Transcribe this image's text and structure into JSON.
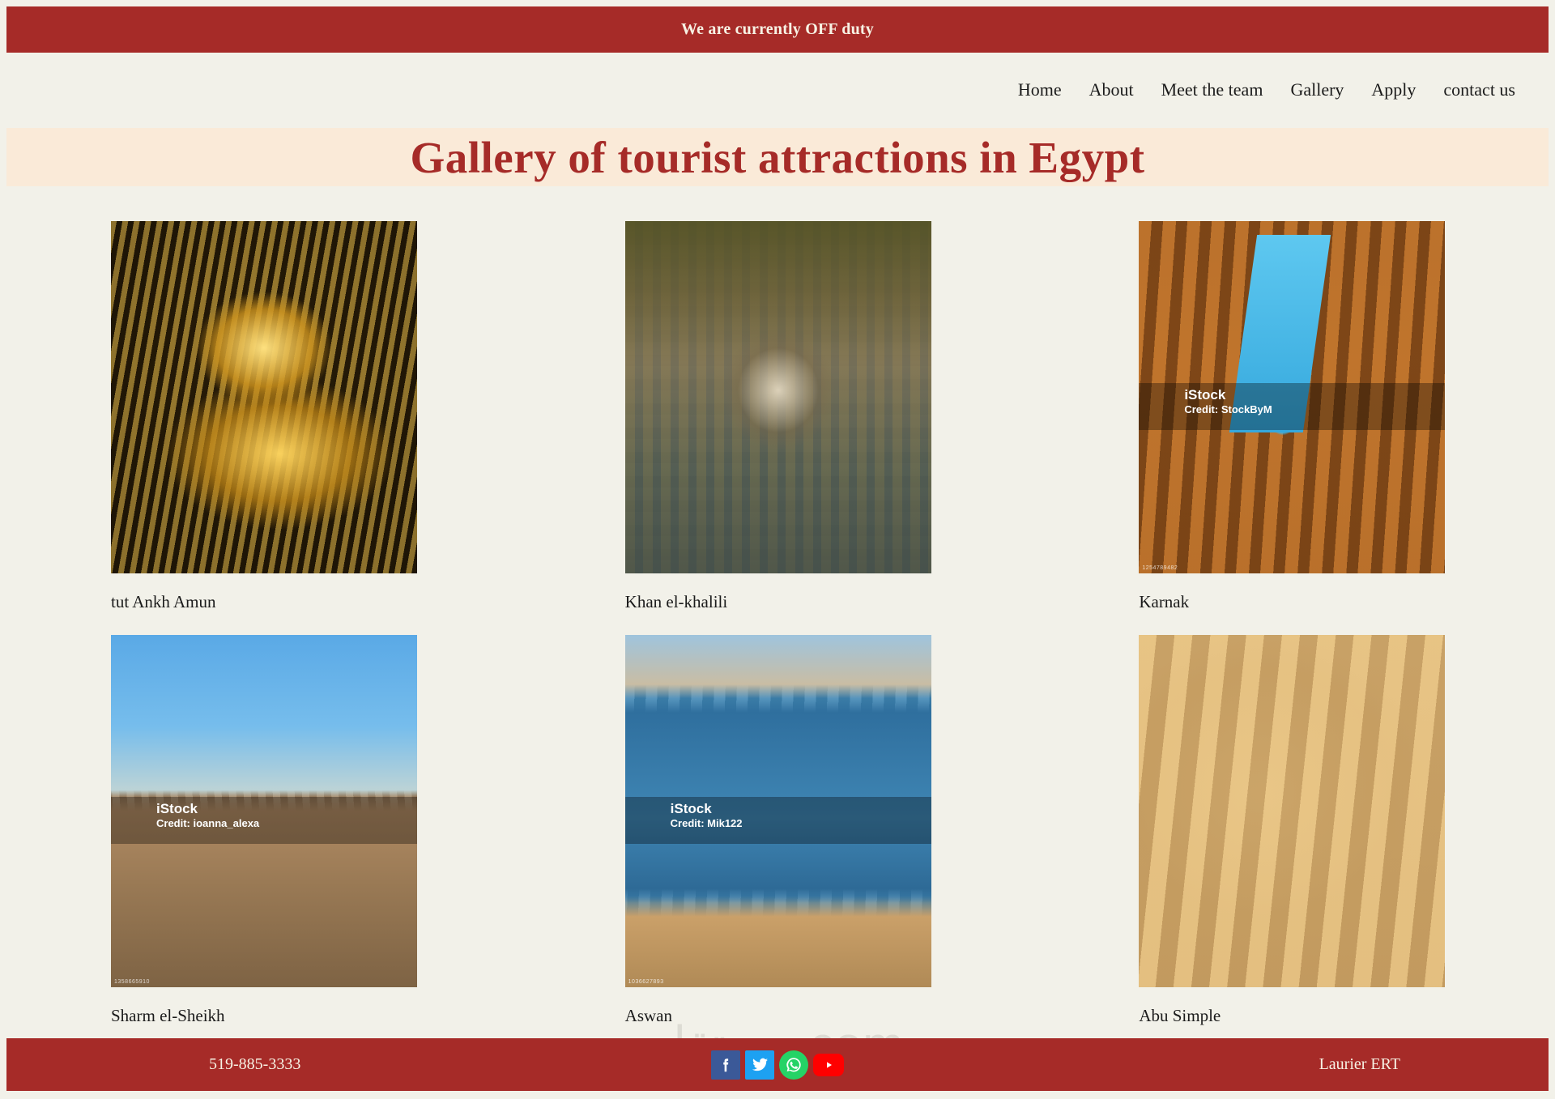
{
  "status_bar": {
    "message": "We are currently OFF duty"
  },
  "nav": {
    "items": [
      {
        "label": "Home",
        "name": "nav-item-home"
      },
      {
        "label": "About",
        "name": "nav-item-about"
      },
      {
        "label": "Meet the team",
        "name": "nav-item-meet-the-team"
      },
      {
        "label": "Gallery",
        "name": "nav-item-gallery"
      },
      {
        "label": "Apply",
        "name": "nav-item-apply"
      },
      {
        "label": "contact us",
        "name": "nav-item-contact-us"
      }
    ]
  },
  "header": {
    "title": "Gallery of tourist attractions in Egypt"
  },
  "gallery": {
    "items": [
      {
        "caption": "tut Ankh Amun",
        "scene": "img-tut",
        "watermark": null,
        "corner": null
      },
      {
        "caption": "Khan el-khalili",
        "scene": "img-khan",
        "watermark": null,
        "corner": null
      },
      {
        "caption": "Karnak",
        "scene": "img-karnak",
        "watermark": {
          "brand": "iStock",
          "credit": "Credit: StockByM"
        },
        "corner": "1254789482"
      },
      {
        "caption": "Sharm el-Sheikh",
        "scene": "img-sharm",
        "watermark": {
          "brand": "iStock",
          "credit": "Credit: ioanna_alexa"
        },
        "corner": "1358665910"
      },
      {
        "caption": "Aswan",
        "scene": "img-aswan",
        "watermark": {
          "brand": "iStock",
          "credit": "Credit: Mik122"
        },
        "corner": "1036627893"
      },
      {
        "caption": "Abu Simple",
        "scene": "img-abu",
        "watermark": null,
        "corner": null
      }
    ]
  },
  "watermark": {
    "text": "مستقل.com"
  },
  "footer": {
    "phone": "519-885-3333",
    "brand": "Laurier ERT",
    "social": [
      {
        "name": "facebook-icon",
        "glyph": "f",
        "class": "ic-fb"
      },
      {
        "name": "twitter-icon",
        "glyph": "ᵗ",
        "class": "ic-tw"
      },
      {
        "name": "whatsapp-icon",
        "glyph": "✆",
        "class": "ic-wa"
      },
      {
        "name": "youtube-icon",
        "glyph": "▶",
        "class": "ic-yt"
      }
    ]
  },
  "colors": {
    "brand_red": "#a62b28",
    "page_bg": "#f2f1e9",
    "banner_bg": "#faead8",
    "title_text": "#a62b28",
    "bar_text": "#f7f2e4"
  }
}
